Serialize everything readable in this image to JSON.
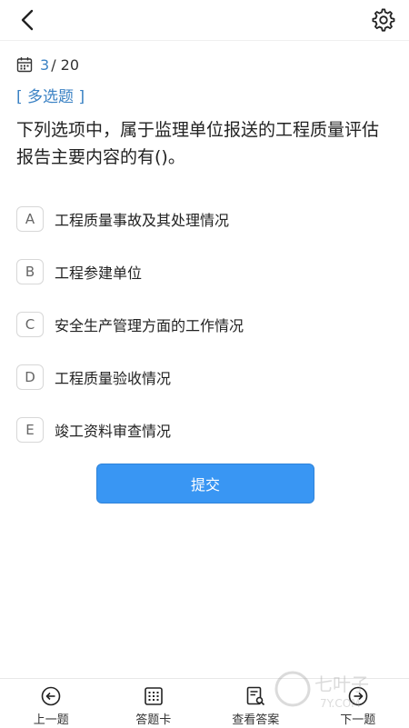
{
  "progress": {
    "current": "3",
    "total": "/ 20"
  },
  "question": {
    "type": "[ 多选题 ]",
    "text": "下列选项中，属于监理单位报送的工程质量评估报告主要内容的有()。"
  },
  "options": [
    {
      "letter": "A",
      "text": "工程质量事故及其处理情况"
    },
    {
      "letter": "B",
      "text": "工程参建单位"
    },
    {
      "letter": "C",
      "text": "安全生产管理方面的工作情况"
    },
    {
      "letter": "D",
      "text": "工程质量验收情况"
    },
    {
      "letter": "E",
      "text": "竣工资料审查情况"
    }
  ],
  "submit_label": "提交",
  "bottom_nav": [
    {
      "label": "上一题",
      "icon": "prev-circle-icon"
    },
    {
      "label": "答题卡",
      "icon": "answer-card-icon"
    },
    {
      "label": "查看答案",
      "icon": "view-answer-icon"
    },
    {
      "label": "下一题",
      "icon": "next-circle-icon"
    }
  ],
  "watermark": {
    "line1": "七叶子",
    "line2": "7Y.COM"
  },
  "colors": {
    "accent": "#3b82c4",
    "button": "#3996f3"
  }
}
